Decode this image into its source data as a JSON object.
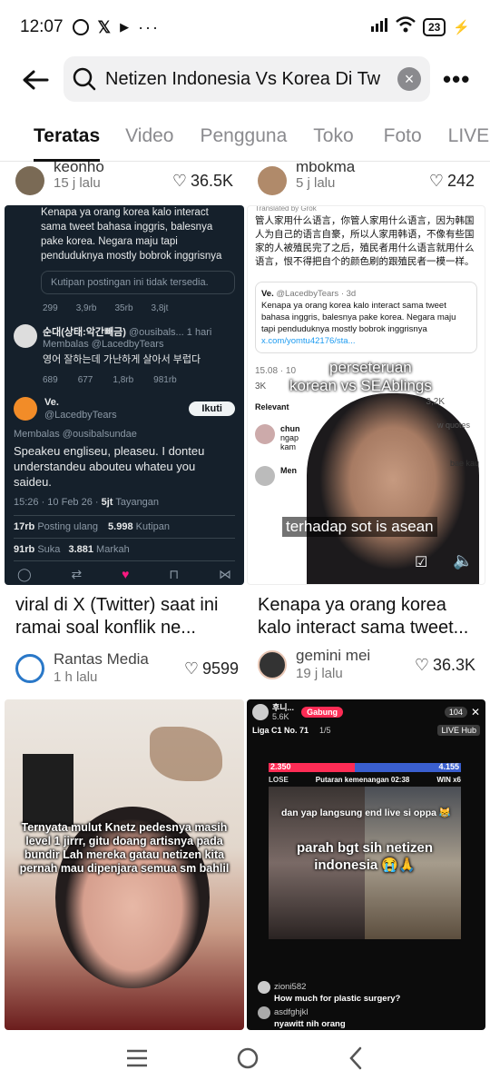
{
  "status": {
    "time": "12:07",
    "battery": "23"
  },
  "search": {
    "query": "Netizen Indonesia Vs Korea Di Tw"
  },
  "tabs": [
    {
      "label": "Teratas"
    },
    {
      "label": "Video"
    },
    {
      "label": "Pengguna"
    },
    {
      "label": "Toko"
    },
    {
      "label": "Foto"
    },
    {
      "label": "LIVE"
    }
  ],
  "top_cards": [
    {
      "user": "keonho",
      "time": "15 j lalu",
      "likes": "36.5K"
    },
    {
      "user": "mbokma",
      "time": "5 j lalu",
      "likes": "242"
    }
  ],
  "card1": {
    "tweet_text": "Kenapa ya orang korea kalo interact sama tweet bahasa inggris, balesnya pake korea. Negara maju tapi penduduknya mostly bobrok inggrisnya",
    "quote_unavailable": "Kutipan postingan ini tidak tersedia.",
    "stats1": [
      "299",
      "3,9rb",
      "35rb",
      "3,8jt"
    ],
    "reply_user": "순대(상태:악간빼금)",
    "reply_handle": "@ousibals...",
    "reply_time": "1 hari",
    "reply_to": "Membalas @LacedbyTears",
    "reply_text": "영어 잘하는데 가난하게 살아서 부럽다",
    "stats2": [
      "689",
      "677",
      "1,8rb",
      "981rb"
    ],
    "main_user": "Ve.",
    "main_handle": "@LacedbyTears",
    "follow": "Ikuti",
    "main_reply_to": "Membalas @ousibalsundae",
    "main_text": "Speakeu engliseu, pleaseu. I donteu understandeu abouteu whateu you saideu.",
    "date": "15:26 · 10 Feb 26 ·",
    "views": "5jt",
    "views_label": "Tayangan",
    "reposts": "17rb",
    "reposts_label": "Posting ulang",
    "quotes": "5.998",
    "quotes_label": "Kutipan",
    "likes": "91rb",
    "likes_label": "Suka",
    "bookmarks": "3.881",
    "bookmarks_label": "Markah",
    "caption": "viral di X (Twitter) saat ini ramai soal konflik ne...",
    "author": "Rantas Media",
    "author_time": "1 h lalu",
    "card_likes": "9599"
  },
  "card2": {
    "translated": "Translated by Grok",
    "chinese": "管人家用什么语言，你管人家用什么语言，因为韩国人为自己的语言自豪，所以人家用韩语，不像有些国家的人被殖民完了之后，殖民者用什么语言就用什么语言，恨不得把自个的颜色刷的跟殖民者一模一样。",
    "quote_user": "Ve.",
    "quote_handle": "@LacedbyTears · 3d",
    "quote_text": "Kenapa ya orang korea kalo interact sama tweet bahasa inggris, balesnya pake korea. Negara maju tapi penduduknya mostly bobrok inggrisnya",
    "quote_link": "x.com/yomtu42176/sta...",
    "date": "15.08 · 10",
    "stats": [
      "3K",
      "3,2K"
    ],
    "relevant": "Relevant",
    "quotes_link": "w quotes",
    "reply1_user": "chun",
    "reply1_text": "ngap",
    "reply1_more": "kam",
    "reply1_right": "bae kau",
    "reply2_user": "Men",
    "overlay_line1": "perseteruan",
    "overlay_line2": "korean vs SEAblings",
    "overlay_bottom": "terhadap sot is asean",
    "caption": "Kenapa ya orang korea kalo interact sama tweet...",
    "author": "gemini mei",
    "author_time": "19 j lalu",
    "card_likes": "36.3K"
  },
  "card3": {
    "overlay_text": "Ternyata mulut Knetz pedesnya masih level 1 jirrr, gitu doang artisnya pada bundir Lah mereka gatau netizen kita pernah mau dipenjara semua sm bahlil"
  },
  "card4": {
    "host": "후니...",
    "host_likes": "5.6K",
    "join": "Gabung",
    "viewers": "104",
    "league": "Liga C1 No. 71",
    "rank": "1/5",
    "live_hub": "LIVE Hub",
    "score_left": "2.350",
    "score_right": "4.155",
    "lose": "LOSE",
    "win": "WIN x6",
    "round": "Putaran kemenangan 02:38",
    "text1": "dan yap langsung end live si oppa 😹",
    "text2": "parah bgt sih netizen indonesia 😭🙏",
    "comment1_user": "zioni582",
    "comment1_text": "How much for plastic surgery?",
    "comment2_user": "asdfghjkl",
    "comment2_text": "nyawitt nih orang"
  },
  "colors": {
    "accent": "#fe2c55",
    "twitter_blue": "#1d9bf0",
    "twitter_bg": "#15202b"
  }
}
